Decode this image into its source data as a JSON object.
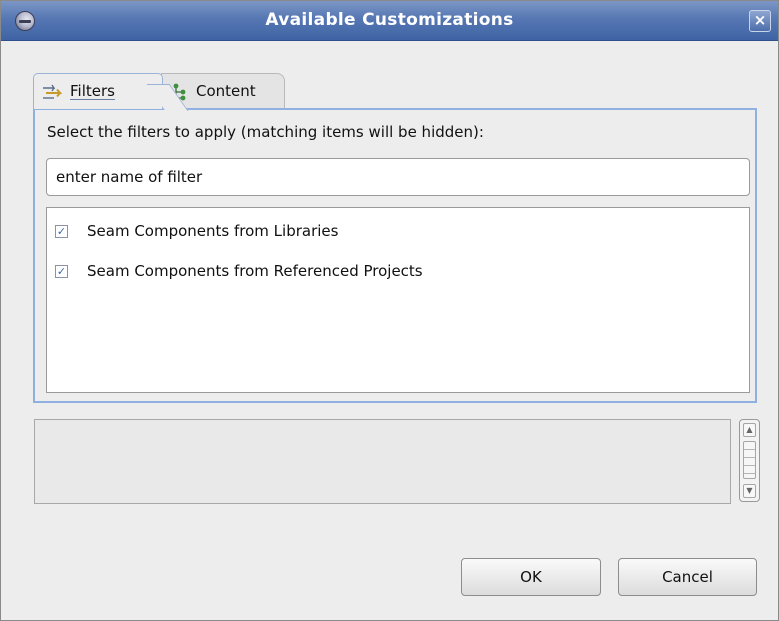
{
  "window": {
    "title": "Available Customizations",
    "close_glyph": "×",
    "app_icon": "eclipse-icon"
  },
  "tabs": [
    {
      "label": "Filters",
      "icon": "filter-icon",
      "selected": true
    },
    {
      "label": "Content",
      "icon": "content-tree-icon",
      "selected": false
    }
  ],
  "filters": {
    "instruction": "Select the filters to apply (matching items will be hidden):",
    "filter_input_value": "enter name of filter",
    "items": [
      {
        "label": "Seam Components from Libraries",
        "checked": true
      },
      {
        "label": "Seam Components from Referenced Projects",
        "checked": true
      }
    ]
  },
  "description": {
    "text": ""
  },
  "buttons": {
    "ok_label": "OK",
    "cancel_label": "Cancel"
  },
  "colors": {
    "titlebar": "#4a6dab",
    "panel_border": "#8fb0e0",
    "check": "#3c64b0"
  }
}
